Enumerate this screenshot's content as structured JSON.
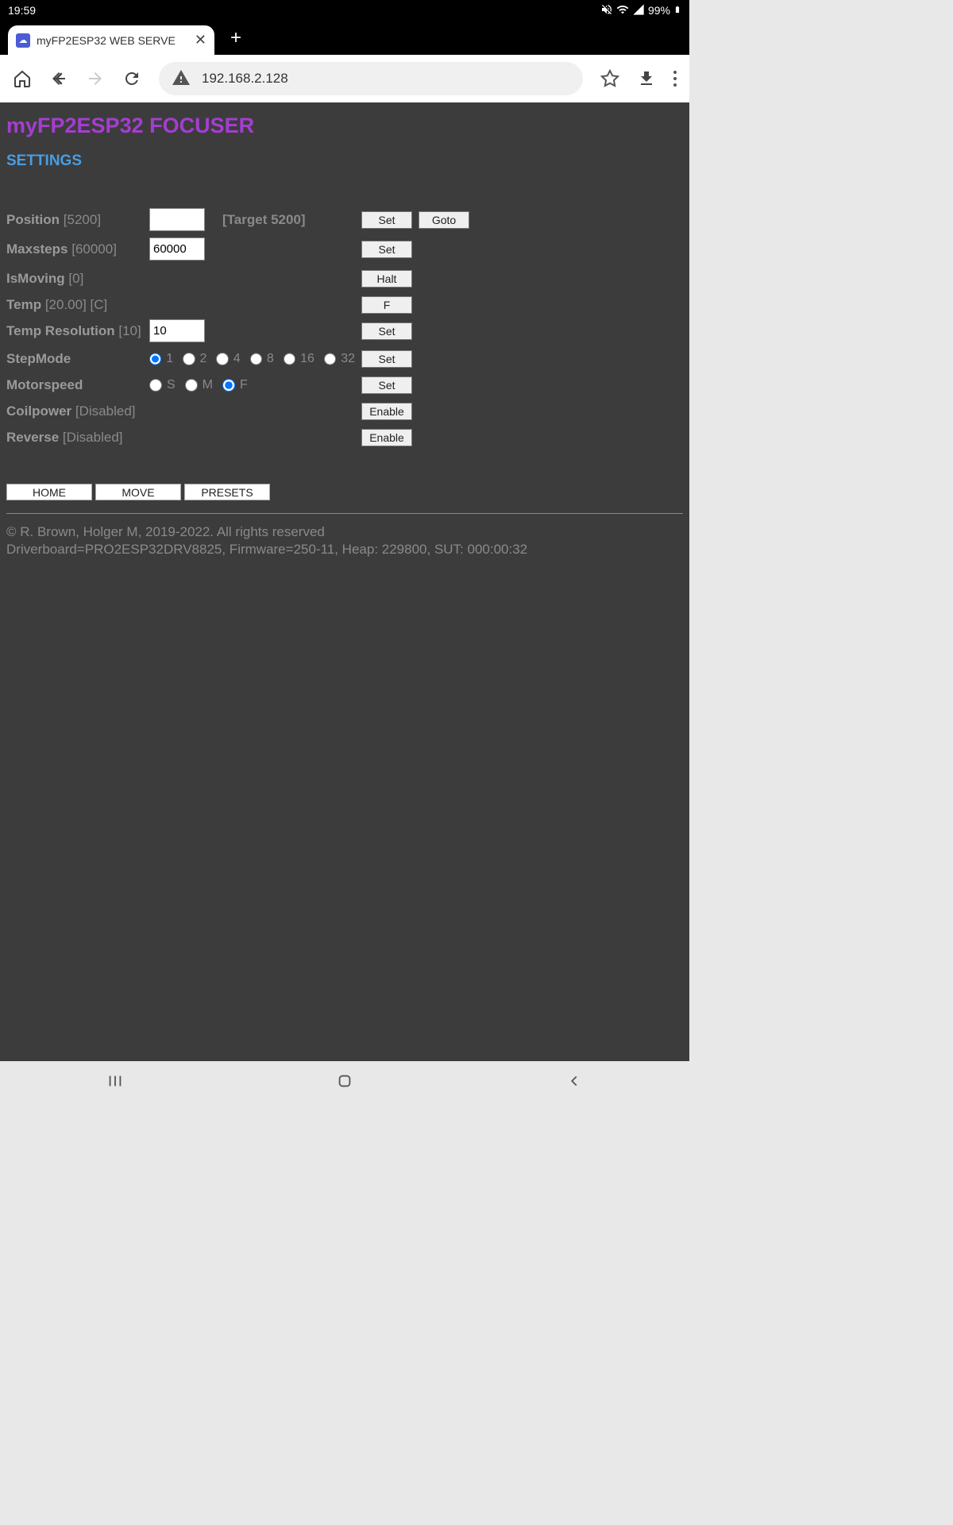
{
  "status_bar": {
    "time": "19:59",
    "battery": "99%"
  },
  "browser": {
    "tab_title": "myFP2ESP32 WEB SERVE",
    "url": "192.168.2.128"
  },
  "page": {
    "title": "myFP2ESP32 FOCUSER",
    "subtitle": "SETTINGS",
    "rows": {
      "position": {
        "label": "Position",
        "value": "[5200]",
        "target": "[Target 5200]",
        "btn1": "Set",
        "btn2": "Goto",
        "input": ""
      },
      "maxsteps": {
        "label": "Maxsteps",
        "value": "[60000]",
        "btn": "Set",
        "input": "60000"
      },
      "ismoving": {
        "label": "IsMoving",
        "value": "[0]",
        "btn": "Halt"
      },
      "temp": {
        "label": "Temp",
        "value": "[20.00] [C]",
        "btn": "F"
      },
      "tempres": {
        "label": "Temp Resolution",
        "value": "[10]",
        "btn": "Set",
        "input": "10"
      },
      "stepmode": {
        "label": "StepMode",
        "btn": "Set",
        "options": [
          "1",
          "2",
          "4",
          "8",
          "16",
          "32"
        ],
        "selected": 0
      },
      "motorspeed": {
        "label": "Motorspeed",
        "btn": "Set",
        "options": [
          "S",
          "M",
          "F"
        ],
        "selected": 2
      },
      "coilpower": {
        "label": "Coilpower",
        "value": "[Disabled]",
        "btn": "Enable"
      },
      "reverse": {
        "label": "Reverse",
        "value": "[Disabled]",
        "btn": "Enable"
      }
    },
    "nav_buttons": {
      "home": "HOME",
      "move": "MOVE",
      "presets": "PRESETS"
    },
    "footer": {
      "line1": "© R. Brown, Holger M, 2019-2022. All rights reserved",
      "line2": "Driverboard=PRO2ESP32DRV8825, Firmware=250-11, Heap: 229800, SUT: 000:00:32"
    }
  }
}
